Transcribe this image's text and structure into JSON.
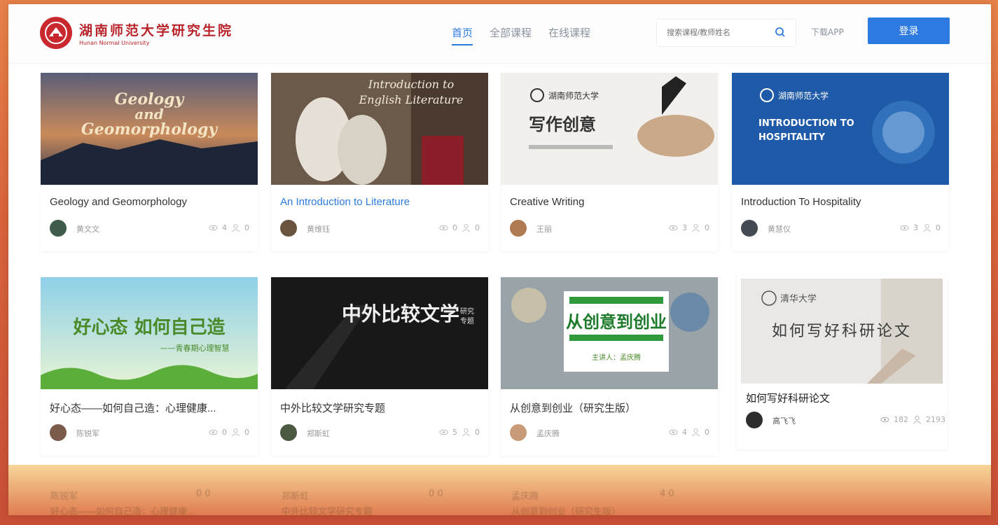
{
  "header": {
    "logo_cn": "湖南师范大学研究生院",
    "logo_en": "Hunan Normal University",
    "nav": [
      {
        "label": "首页",
        "active": true
      },
      {
        "label": "全部课程",
        "active": false
      },
      {
        "label": "在线课程",
        "active": false
      }
    ],
    "search_placeholder": "搜索课程/教师姓名",
    "download_label": "下载APP",
    "login_label": "登录",
    "accent": "#2d7be0"
  },
  "courses": [
    {
      "title": "Geology and Geomorphology",
      "teacher": "黄文文",
      "views": "4",
      "students": "0",
      "link": false,
      "thumb_text": "Geology and Geomorphology"
    },
    {
      "title": "An Introduction to Literature",
      "teacher": "黄维钰",
      "views": "0",
      "students": "0",
      "link": true,
      "thumb_text": "Introduction to English Literature"
    },
    {
      "title": "Creative Writing",
      "teacher": "王丽",
      "views": "3",
      "students": "0",
      "link": false,
      "thumb_text": "写作创意"
    },
    {
      "title": "Introduction To Hospitality",
      "teacher": "黄慧仪",
      "views": "3",
      "students": "0",
      "link": false,
      "thumb_text": "INTRODUCTION TO HOSPITALITY"
    },
    {
      "title": "好心态——如何自己造：心理健康...",
      "teacher": "陈锐军",
      "views": "0",
      "students": "0",
      "link": false,
      "thumb_text": "好心态 如何自己造"
    },
    {
      "title": "中外比较文学研究专题",
      "teacher": "郑斯虹",
      "views": "5",
      "students": "0",
      "link": false,
      "thumb_text": "中外比较文学研究专题"
    },
    {
      "title": "从创意到创业（研究生版）",
      "teacher": "孟庆腾",
      "views": "4",
      "students": "0",
      "link": false,
      "thumb_text": "从创意到创业"
    },
    {
      "title": "如何写好科研论文",
      "teacher": "高飞飞",
      "views": "182",
      "students": "2193",
      "link": false,
      "thumb_text": "如何写好科研论文"
    }
  ],
  "ghost_row": [
    {
      "title": "好心态——如何自己造：心理健康...",
      "teacher": "陈锐军",
      "stats": "0 0"
    },
    {
      "title": "中外比较文学研究专题",
      "teacher": "郑斯虹",
      "stats": "0 0"
    },
    {
      "title": "从创意到创业（研究生版）",
      "teacher": "孟庆腾",
      "stats": "4 0"
    }
  ]
}
